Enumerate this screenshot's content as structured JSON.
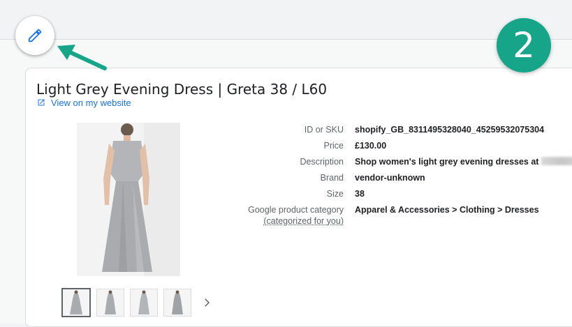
{
  "step_number": "2",
  "product": {
    "title": "Light Grey Evening Dress | Greta 38 / L60",
    "view_link_label": "View on my website"
  },
  "details": [
    {
      "label": "ID or SKU",
      "value": "shopify_GB_8311495328040_45259532075304"
    },
    {
      "label": "Price",
      "value": "£130.00"
    },
    {
      "label": "Description",
      "value": "Shop women's light grey evening dresses at"
    },
    {
      "label": "Brand",
      "value": "vendor-unknown"
    },
    {
      "label": "Size",
      "value": "38"
    },
    {
      "label": "Google product category",
      "sublabel": "(categorized for you)",
      "value": "Apparel & Accessories > Clothing > Dresses"
    }
  ],
  "icons": {
    "edit": "pencil-icon",
    "external": "external-link-icon",
    "next": "chevron-right-icon"
  },
  "colors": {
    "accent_blue": "#1a73e8",
    "annotation_green": "#17a58a"
  }
}
